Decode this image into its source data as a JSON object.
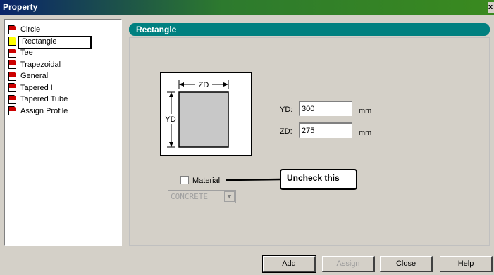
{
  "window": {
    "title": "Property",
    "close_label": "x"
  },
  "tree": {
    "items": [
      {
        "label": "Circle",
        "selected": false,
        "icon": "document-icon"
      },
      {
        "label": "Rectangle",
        "selected": true,
        "icon": "document-icon"
      },
      {
        "label": "Tee",
        "selected": false,
        "icon": "document-icon"
      },
      {
        "label": "Trapezoidal",
        "selected": false,
        "icon": "document-icon"
      },
      {
        "label": "General",
        "selected": false,
        "icon": "document-icon"
      },
      {
        "label": "Tapered I",
        "selected": false,
        "icon": "document-icon"
      },
      {
        "label": "Tapered Tube",
        "selected": false,
        "icon": "document-icon"
      },
      {
        "label": "Assign Profile",
        "selected": false,
        "icon": "document-icon"
      }
    ]
  },
  "panel": {
    "title": "Rectangle"
  },
  "diagram": {
    "zd_label": "ZD",
    "yd_label": "YD"
  },
  "fields": {
    "yd": {
      "label": "YD:",
      "value": "300",
      "unit": "mm"
    },
    "zd": {
      "label": "ZD:",
      "value": "275",
      "unit": "mm"
    }
  },
  "material": {
    "label": "Material",
    "checked": false,
    "selected": "CONCRETE"
  },
  "callout": {
    "text": "Uncheck this"
  },
  "buttons": {
    "add": "Add",
    "assign": "Assign",
    "close": "Close",
    "help": "Help"
  },
  "colors": {
    "header": "#008080",
    "selected_icon": "#ffff00",
    "icon_red": "#cc0000",
    "dialog_bg": "#d4d0c8"
  }
}
